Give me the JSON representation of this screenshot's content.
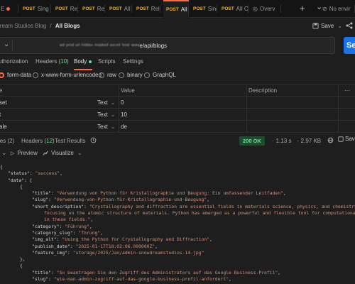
{
  "tabs": [
    {
      "method": "",
      "label": "All E",
      "dot": true
    },
    {
      "method": "POST",
      "label": "Sing",
      "dot": true
    },
    {
      "method": "POST",
      "label": "Rele",
      "dot": true
    },
    {
      "method": "POST",
      "label": "Rele",
      "dot": true
    },
    {
      "method": "POST",
      "label": "All S",
      "dot": true
    },
    {
      "method": "POST",
      "label": "Rele",
      "dot": false
    },
    {
      "method": "POST",
      "label": "All E",
      "dot": true,
      "active": true
    },
    {
      "method": "POST",
      "label": "Sing",
      "dot": false
    },
    {
      "method": "POST",
      "label": "All C",
      "dot": false
    },
    {
      "method": "",
      "label": "Overv",
      "dot": false
    },
    {
      "method": "",
      "label": "No envir",
      "dot": false
    }
  ],
  "tab_actions": {
    "add": "+",
    "more": "⌄"
  },
  "breadcrumb": {
    "parent": "Dream Studios Blog",
    "separator": "/",
    "current": "All Blogs"
  },
  "header_actions": {
    "save_label": "Save",
    "share_icon": "share-icon"
  },
  "request": {
    "method_chevron": "⌄",
    "url_prefix": "ʷᵈ ᵖʳᵒᵈ ᵘʳˡ ʰⁱᵈᵈᵉⁿ ᵐᵃˢᵏᵉᵈ ˢᵉᶜʳᵉᵗ ʰᵒˢᵗ ʷʷʷ",
    "url_suffix": "e/api/blogs",
    "send_label": "Se"
  },
  "request_tabs": [
    {
      "label": "uthorization"
    },
    {
      "label": "Headers",
      "count": "(10)"
    },
    {
      "label": "Body",
      "active": true
    },
    {
      "label": "Scripts"
    },
    {
      "label": "Settings"
    }
  ],
  "body_types": [
    {
      "label": "form-data",
      "selected": true
    },
    {
      "label": "x-www-form-urlencoded",
      "selected": false
    },
    {
      "label": "raw",
      "selected": false
    },
    {
      "label": "binary",
      "selected": false
    },
    {
      "label": "GraphQL",
      "selected": false
    }
  ],
  "table": {
    "headers": [
      "e",
      "Value",
      "Description",
      "⋯"
    ],
    "rows": [
      {
        "key": "set",
        "type": "Text",
        "value": "0"
      },
      {
        "key": "t",
        "type": "Text",
        "value": "10"
      },
      {
        "key": "ale",
        "type": "Text",
        "value": "de"
      }
    ]
  },
  "response_bar": {
    "tabs": [
      {
        "label": "ies",
        "count": "(2)"
      },
      {
        "label": "Headers",
        "count": "(12)"
      },
      {
        "label": "Test Results"
      }
    ],
    "status": "200 OK",
    "time": "1.13 s",
    "size": "2.97 KB",
    "save_response": "Save Re"
  },
  "viewer": {
    "preview_label": "Preview",
    "visualize_label": "Visualize"
  },
  "json_lines": [
    {
      "i": 0,
      "p": [
        [
          "p",
          "{"
        ]
      ]
    },
    {
      "i": 1,
      "p": [
        [
          "k",
          "\"status\""
        ],
        [
          "p",
          ": "
        ],
        [
          "s",
          "\"success\""
        ],
        [
          "p",
          ","
        ]
      ]
    },
    {
      "i": 1,
      "p": [
        [
          "k",
          "\"data\""
        ],
        [
          "p",
          ": ["
        ]
      ]
    },
    {
      "i": 2,
      "p": [
        [
          "p",
          "{"
        ]
      ]
    },
    {
      "i": 3,
      "p": [
        [
          "k",
          "\"title\""
        ],
        [
          "p",
          ": "
        ],
        [
          "s",
          "\"Verwendung von Python für Kristallographie und Beugung: Ein umfassender Leitfaden\""
        ],
        [
          "p",
          ","
        ]
      ]
    },
    {
      "i": 3,
      "p": [
        [
          "k",
          "\"slug\""
        ],
        [
          "p",
          ": "
        ],
        [
          "s",
          "\"Verwendung-von-Python-für-Kristallographie-und-Beugung\""
        ],
        [
          "p",
          ","
        ]
      ]
    },
    {
      "i": 3,
      "p": [
        [
          "k",
          "\"short_description\""
        ],
        [
          "p",
          ": "
        ],
        [
          "s",
          "\"Crystallography and diffraction are essential fields in materials science, physics, and chemistry,"
        ]
      ]
    },
    {
      "i": 4,
      "p": [
        [
          "s",
          "focusing on the atomic structure of materials. Python has emerged as a powerful and flexible tool for computational"
        ]
      ]
    },
    {
      "i": 4,
      "p": [
        [
          "s",
          "in these fields.\""
        ],
        [
          "p",
          ","
        ]
      ]
    },
    {
      "i": 3,
      "p": [
        [
          "k",
          "\"category\""
        ],
        [
          "p",
          ": "
        ],
        [
          "s",
          "\"Führung\""
        ],
        [
          "p",
          ","
        ]
      ]
    },
    {
      "i": 3,
      "p": [
        [
          "k",
          "\"category_slug\""
        ],
        [
          "p",
          ": "
        ],
        [
          "s",
          "\"fhrung\""
        ],
        [
          "p",
          ","
        ]
      ]
    },
    {
      "i": 3,
      "p": [
        [
          "k",
          "\"img_alt\""
        ],
        [
          "p",
          ": "
        ],
        [
          "s",
          "\"Using the Python for Crystallography and Diffraction\""
        ],
        [
          "p",
          ","
        ]
      ]
    },
    {
      "i": 3,
      "p": [
        [
          "k",
          "\"publish_date\""
        ],
        [
          "p",
          ": "
        ],
        [
          "s",
          "\"2025-01-17T18:02:06.000000Z\""
        ],
        [
          "p",
          ","
        ]
      ]
    },
    {
      "i": 3,
      "p": [
        [
          "k",
          "\"feature_img\""
        ],
        [
          "p",
          ": "
        ],
        [
          "s",
          "\"storage/2025/Jan/admin-snowdreamstudios-14.jpg\""
        ]
      ]
    },
    {
      "i": 2,
      "p": [
        [
          "p",
          "},"
        ]
      ]
    },
    {
      "i": 2,
      "p": [
        [
          "p",
          "{"
        ]
      ]
    },
    {
      "i": 3,
      "p": [
        [
          "k",
          "\"title\""
        ],
        [
          "p",
          ": "
        ],
        [
          "s",
          "\"So beantragen Sie den Zugriff des Administrators auf das Google Business-Profil\""
        ],
        [
          "p",
          ","
        ]
      ]
    },
    {
      "i": 3,
      "p": [
        [
          "k",
          "\"slug\""
        ],
        [
          "p",
          ": "
        ],
        [
          "s",
          "\"wie-man-admin-zugriff-auf-das-google-business-profil-anfordert\""
        ],
        [
          "p",
          ","
        ]
      ]
    }
  ]
}
